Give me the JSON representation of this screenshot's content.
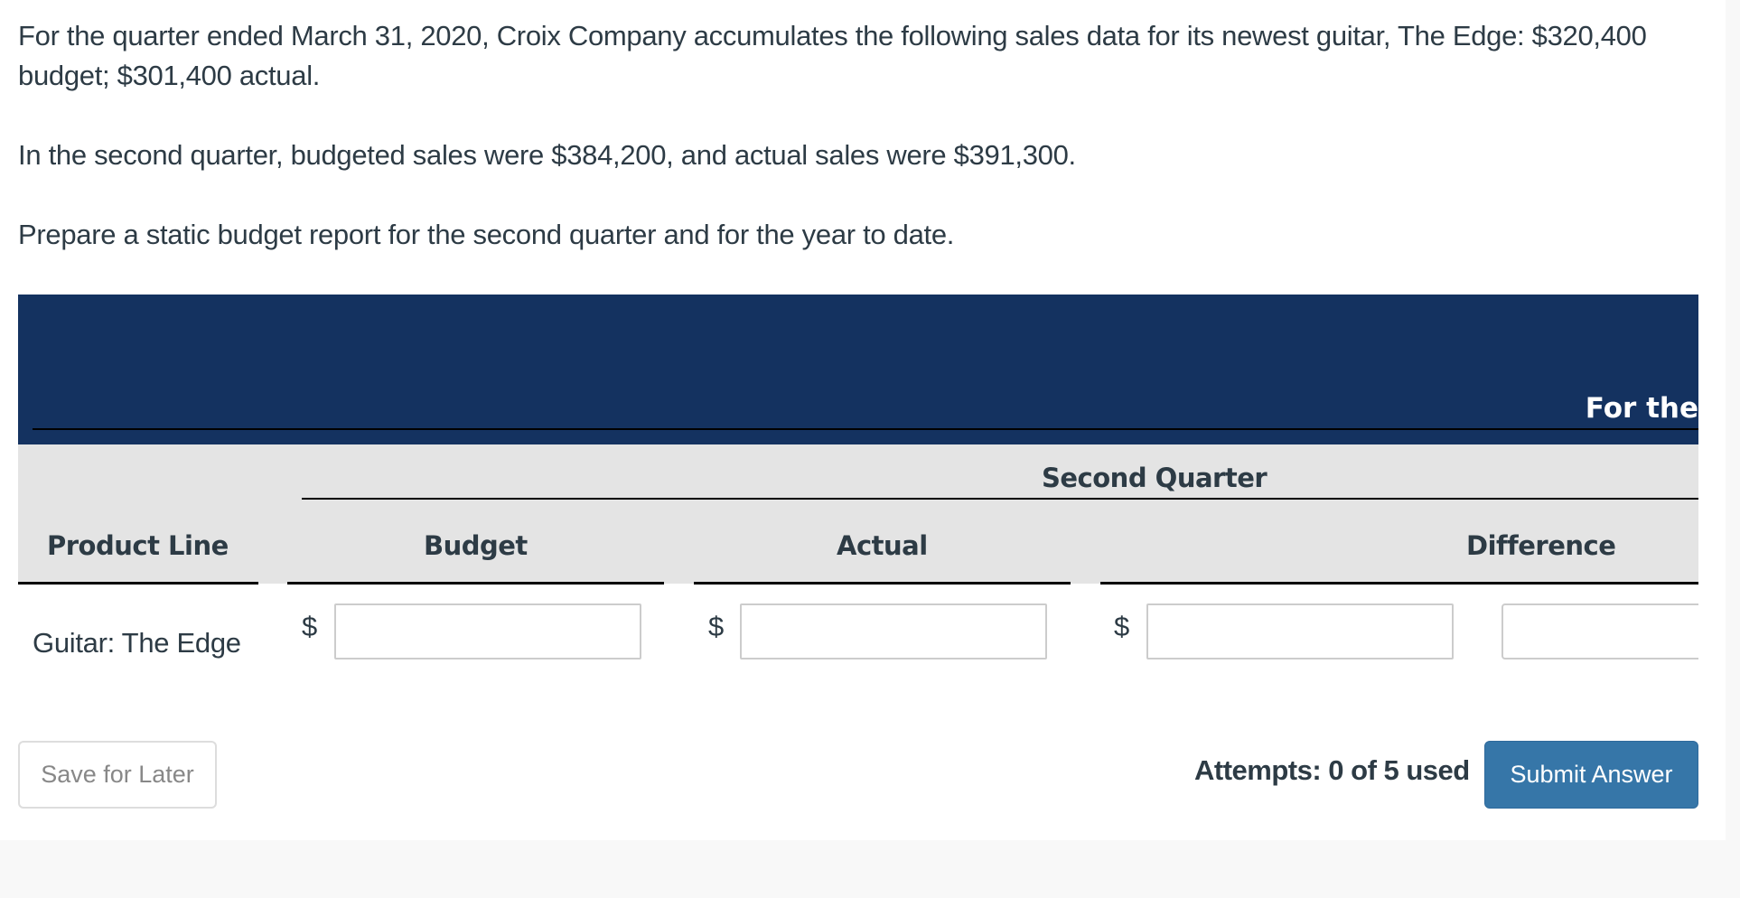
{
  "question": {
    "paragraph_1": "For the quarter ended March 31, 2020, Croix Company accumulates the following sales data for its newest guitar, The Edge: $320,400 budget; $301,400 actual.",
    "paragraph_2": "In the second quarter, budgeted sales were $384,200, and actual sales were $391,300.",
    "paragraph_3": "Prepare a static budget report for the second quarter and for the year to date."
  },
  "report": {
    "header_partial_title": "For the",
    "group_header": "Second Quarter",
    "columns": {
      "product_line": "Product Line",
      "budget": "Budget",
      "actual": "Actual",
      "difference": "Difference"
    },
    "rows": [
      {
        "label": "Guitar: The Edge",
        "currency_symbol": "$",
        "budget_value": "",
        "actual_value": "",
        "difference_value": "",
        "next_value": ""
      }
    ]
  },
  "footer": {
    "save_label": "Save for Later",
    "attempts_text": "Attempts: 0 of 5 used",
    "submit_label": "Submit Answer"
  },
  "colors": {
    "header_navy": "#143260",
    "header_gray": "#e4e4e4",
    "submit_blue": "#3676a8",
    "text": "#2d3b45"
  }
}
